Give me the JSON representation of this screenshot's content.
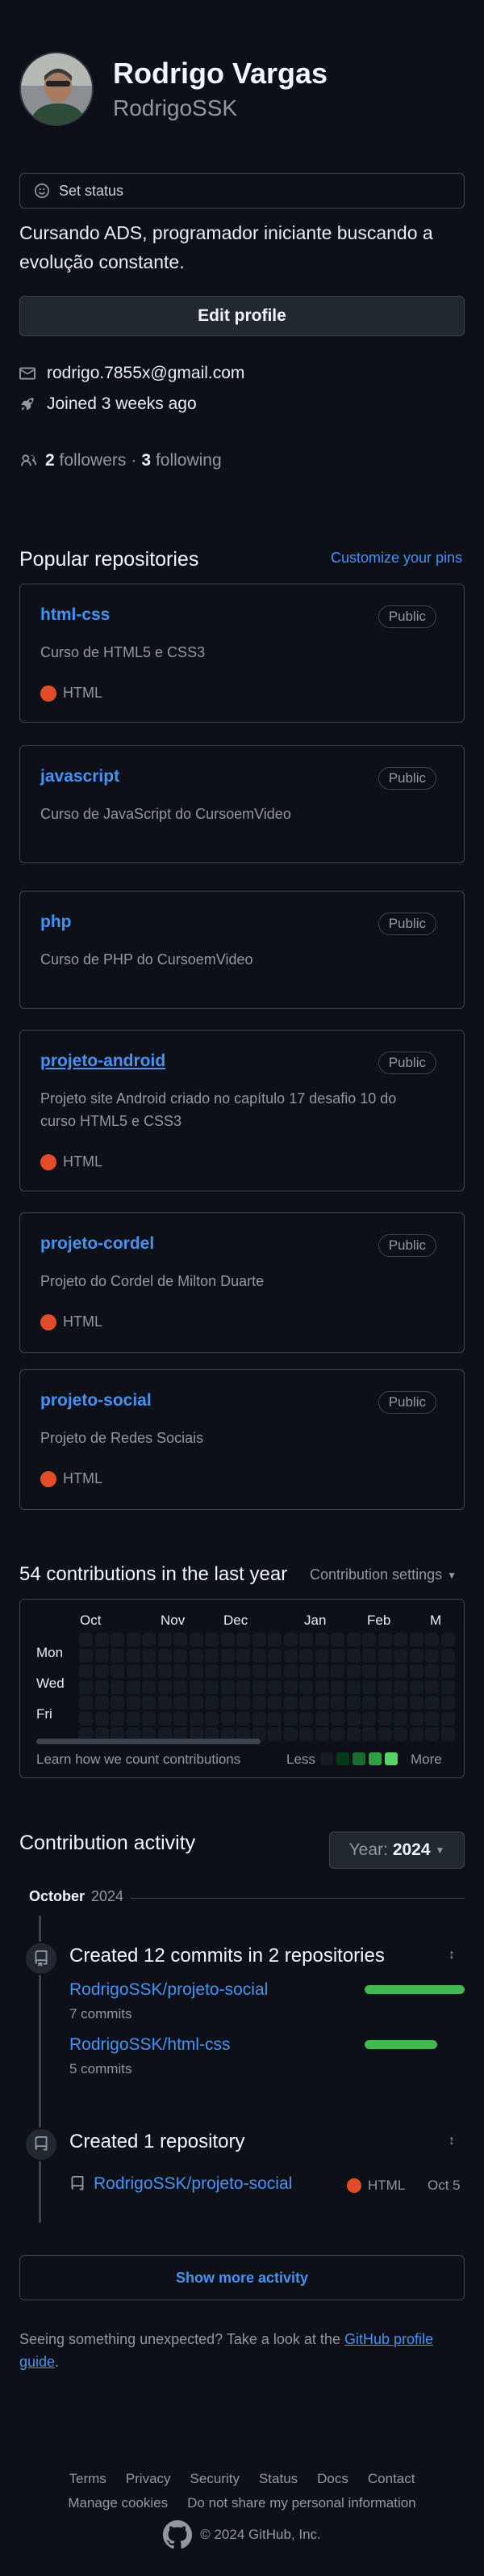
{
  "profile": {
    "name": "Rodrigo Vargas",
    "login": "RodrigoSSK",
    "set_status": "Set status",
    "bio": "Cursando ADS, programador iniciante buscando a evolução constante.",
    "edit_profile": "Edit profile",
    "email": "rodrigo.7855x@gmail.com",
    "joined": "Joined 3 weeks ago",
    "followers_count": "2",
    "followers_label": "followers",
    "separator": "·",
    "following_count": "3",
    "following_label": "following"
  },
  "pinned": {
    "title": "Popular repositories",
    "customize": "Customize your pins",
    "repos": [
      {
        "name": "html-css",
        "visibility": "Public",
        "description": "Curso de HTML5 e CSS3",
        "language": "HTML"
      },
      {
        "name": "javascript",
        "visibility": "Public",
        "description": "Curso de JavaScript do CursoemVideo",
        "language": ""
      },
      {
        "name": "php",
        "visibility": "Public",
        "description": "Curso de PHP do CursoemVideo",
        "language": ""
      },
      {
        "name": "projeto-android",
        "visibility": "Public",
        "description": "Projeto site Android criado no capítulo 17 desafio 10 do curso HTML5 e CSS3",
        "language": "HTML"
      },
      {
        "name": "projeto-cordel",
        "visibility": "Public",
        "description": "Projeto do Cordel de Milton Duarte",
        "language": "HTML"
      },
      {
        "name": "projeto-social",
        "visibility": "Public",
        "description": "Projeto de Redes Sociais",
        "language": "HTML"
      }
    ],
    "language_color": "#e34c26"
  },
  "contributions": {
    "title": "54 contributions in the last year",
    "settings": "Contribution settings",
    "months": [
      "Oct",
      "Nov",
      "Dec",
      "Jan",
      "Feb",
      "M"
    ],
    "days": [
      "Mon",
      "Wed",
      "Fri"
    ],
    "learn": "Learn how we count contributions",
    "less": "Less",
    "more": "More",
    "legend_colors": [
      "#151b23",
      "#033a16",
      "#196c2e",
      "#2ea043",
      "#56d364"
    ]
  },
  "activity": {
    "title": "Contribution activity",
    "year_label": "Year:",
    "year_value": "2024",
    "month": "October",
    "month_year": "2024",
    "commits_heading": "Created 12 commits in 2 repositories",
    "commit_repos": [
      {
        "name": "RodrigoSSK/projeto-social",
        "count": "7 commits",
        "fraction": 0.58
      },
      {
        "name": "RodrigoSSK/html-css",
        "count": "5 commits",
        "fraction": 0.42
      }
    ],
    "repo_heading": "Created 1 repository",
    "created_repo": {
      "name": "RodrigoSSK/projeto-social",
      "language": "HTML",
      "date": "Oct 5"
    },
    "show_more": "Show more activity",
    "feedback_prefix": "Seeing something unexpected? Take a look at the",
    "feedback_link": "GitHub profile guide",
    "feedback_suffix": "."
  },
  "footer": {
    "links": [
      "Terms",
      "Privacy",
      "Security",
      "Status",
      "Docs",
      "Contact",
      "Manage cookies",
      "Do not share my personal information"
    ],
    "copyright": "© 2024 GitHub, Inc."
  }
}
